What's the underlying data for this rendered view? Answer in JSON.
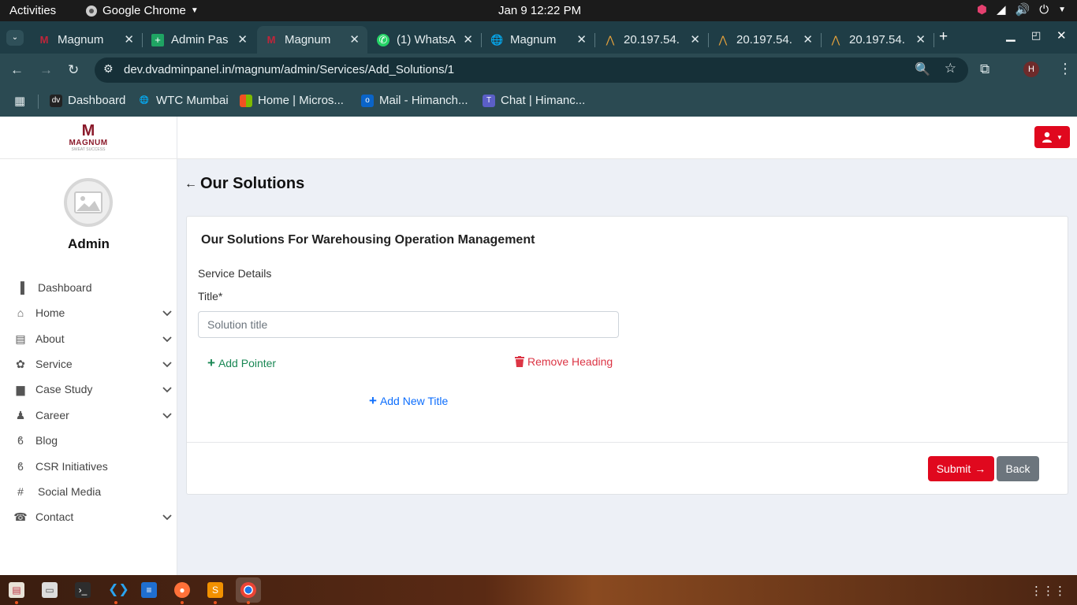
{
  "system": {
    "activities": "Activities",
    "app_name": "Google Chrome",
    "clock": "Jan 9  12:22 PM"
  },
  "tabs": [
    {
      "label": "Magnum",
      "icon": "magnum-icon",
      "active": false
    },
    {
      "label": "Admin Pas",
      "icon": "sheets-icon",
      "active": false
    },
    {
      "label": "Magnum",
      "icon": "magnum-icon",
      "active": true
    },
    {
      "label": "(1) WhatsA",
      "icon": "whatsapp-icon",
      "active": false
    },
    {
      "label": "Magnum",
      "icon": "globe-icon",
      "active": false
    },
    {
      "label": "20.197.54.",
      "icon": "server-icon",
      "active": false
    },
    {
      "label": "20.197.54.",
      "icon": "server-icon",
      "active": false
    },
    {
      "label": "20.197.54.",
      "icon": "server-icon",
      "active": false
    }
  ],
  "address": {
    "url": "dev.dvadminpanel.in/magnum/admin/Services/Add_Solutions/1",
    "profile_initial": "H"
  },
  "bookmarks": [
    {
      "label": "Dashboard",
      "icon": "dv-icon"
    },
    {
      "label": "WTC Mumbai",
      "icon": "globe-icon"
    },
    {
      "label": "Home | Micros...",
      "icon": "microsoft-icon"
    },
    {
      "label": "Mail - Himanch...",
      "icon": "outlook-icon"
    },
    {
      "label": "Chat | Himanc...",
      "icon": "teams-icon"
    }
  ],
  "sidebar": {
    "logo_mark": "M",
    "logo_text": "MAGNUM",
    "logo_tagline": "SWEAT SUCCESS",
    "user_name": "Admin",
    "items": [
      {
        "label": "Dashboard",
        "icon": "chart-icon",
        "has_submenu": false
      },
      {
        "label": "Home",
        "icon": "home-icon",
        "has_submenu": true
      },
      {
        "label": "About",
        "icon": "id-card-icon",
        "has_submenu": true
      },
      {
        "label": "Service",
        "icon": "gear-icon",
        "has_submenu": true
      },
      {
        "label": "Case Study",
        "icon": "book-icon",
        "has_submenu": true
      },
      {
        "label": "Career",
        "icon": "user-tie-icon",
        "has_submenu": true
      },
      {
        "label": "Blog",
        "icon": "blog-icon",
        "has_submenu": false
      },
      {
        "label": "CSR Initiatives",
        "icon": "blog-icon",
        "has_submenu": false
      },
      {
        "label": "Social Media",
        "icon": "hashtag-icon",
        "has_submenu": false
      },
      {
        "label": "Contact",
        "icon": "phone-icon",
        "has_submenu": true
      }
    ]
  },
  "main": {
    "page_title": "Our Solutions",
    "card_title": "Our Solutions For Warehousing Operation Management",
    "section_label": "Service Details",
    "title_label": "Title*",
    "title_placeholder": "Solution title",
    "title_value": "",
    "add_pointer": "Add Pointer",
    "remove_heading": "Remove Heading",
    "add_new_title": "Add New Title",
    "submit": "Submit",
    "back": "Back"
  },
  "colors": {
    "accent": "#e0081e",
    "green": "#198754",
    "red": "#dc3545",
    "blue": "#0d6efd",
    "brand": "#8b1a2b"
  }
}
